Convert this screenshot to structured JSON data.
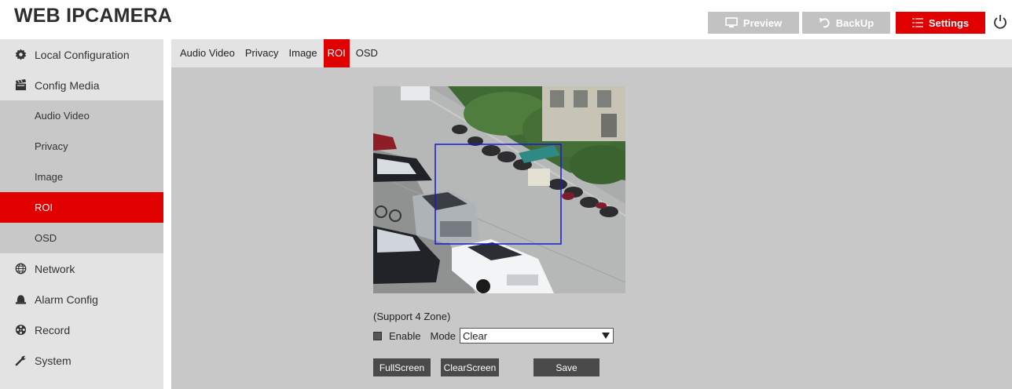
{
  "header": {
    "title": "WEB IPCAMERA",
    "preview_label": "Preview",
    "backup_label": "BackUp",
    "settings_label": "Settings"
  },
  "sidebar": {
    "items": [
      {
        "label": "Local Configuration",
        "icon": "gear-icon"
      },
      {
        "label": "Config Media",
        "icon": "clapperboard-icon"
      },
      {
        "label": "Network",
        "icon": "globe-icon"
      },
      {
        "label": "Alarm Config",
        "icon": "bell-icon"
      },
      {
        "label": "Record",
        "icon": "film-reel-icon"
      },
      {
        "label": "System",
        "icon": "wrench-icon"
      }
    ],
    "media_subitems": [
      "Audio Video",
      "Privacy",
      "Image",
      "ROI",
      "OSD"
    ],
    "active_subitem": "ROI"
  },
  "tabs": [
    "Audio Video",
    "Privacy",
    "Image",
    "ROI",
    "OSD"
  ],
  "active_tab": "ROI",
  "roi": {
    "zone_note": "(Support 4 Zone)",
    "enable_label": "Enable",
    "mode_label": "Mode",
    "mode_value": "Clear"
  },
  "actions": {
    "fullscreen_label": "FullScreen",
    "clearscreen_label": "ClearScreen",
    "save_label": "Save"
  },
  "colors": {
    "accent": "#e00000",
    "sidebar_bg": "#e3e3e3",
    "submenu_bg": "#c8c8c8",
    "roi_box": "#1a1ad0"
  }
}
